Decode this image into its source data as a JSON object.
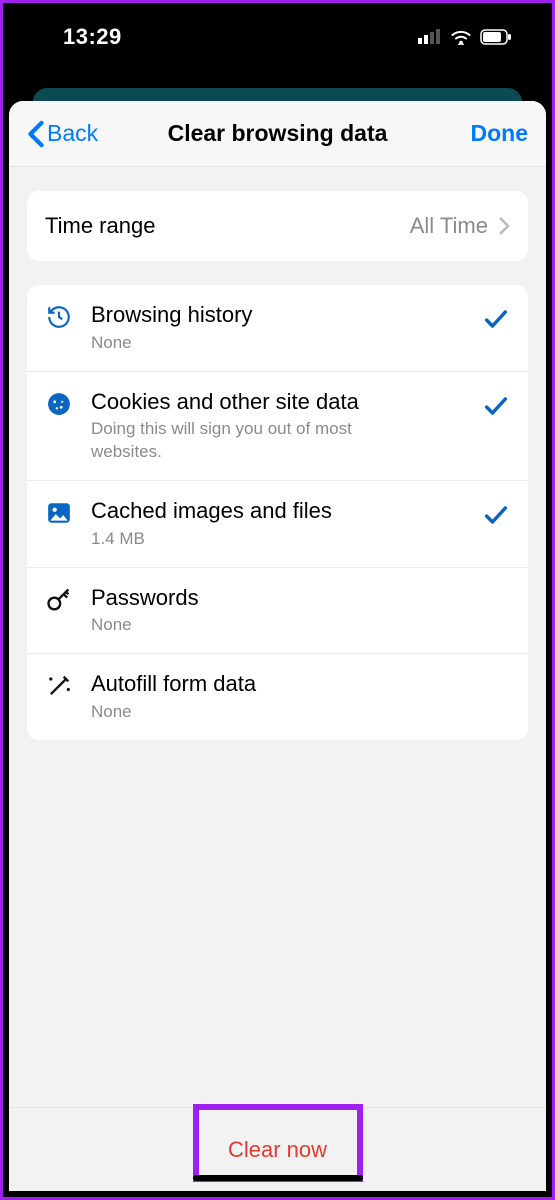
{
  "status": {
    "time": "13:29"
  },
  "nav": {
    "back": "Back",
    "title": "Clear browsing data",
    "done": "Done"
  },
  "timerange": {
    "label": "Time range",
    "value": "All Time"
  },
  "items": [
    {
      "icon": "history",
      "title": "Browsing history",
      "sub": "None",
      "checked": true
    },
    {
      "icon": "cookie",
      "title": "Cookies and other site data",
      "sub": "Doing this will sign you out of most websites.",
      "checked": true
    },
    {
      "icon": "image",
      "title": "Cached images and files",
      "sub": "1.4 MB",
      "checked": true
    },
    {
      "icon": "key",
      "title": "Passwords",
      "sub": "None",
      "checked": false
    },
    {
      "icon": "wand",
      "title": "Autofill form data",
      "sub": "None",
      "checked": false
    }
  ],
  "clear": {
    "label": "Clear now"
  }
}
